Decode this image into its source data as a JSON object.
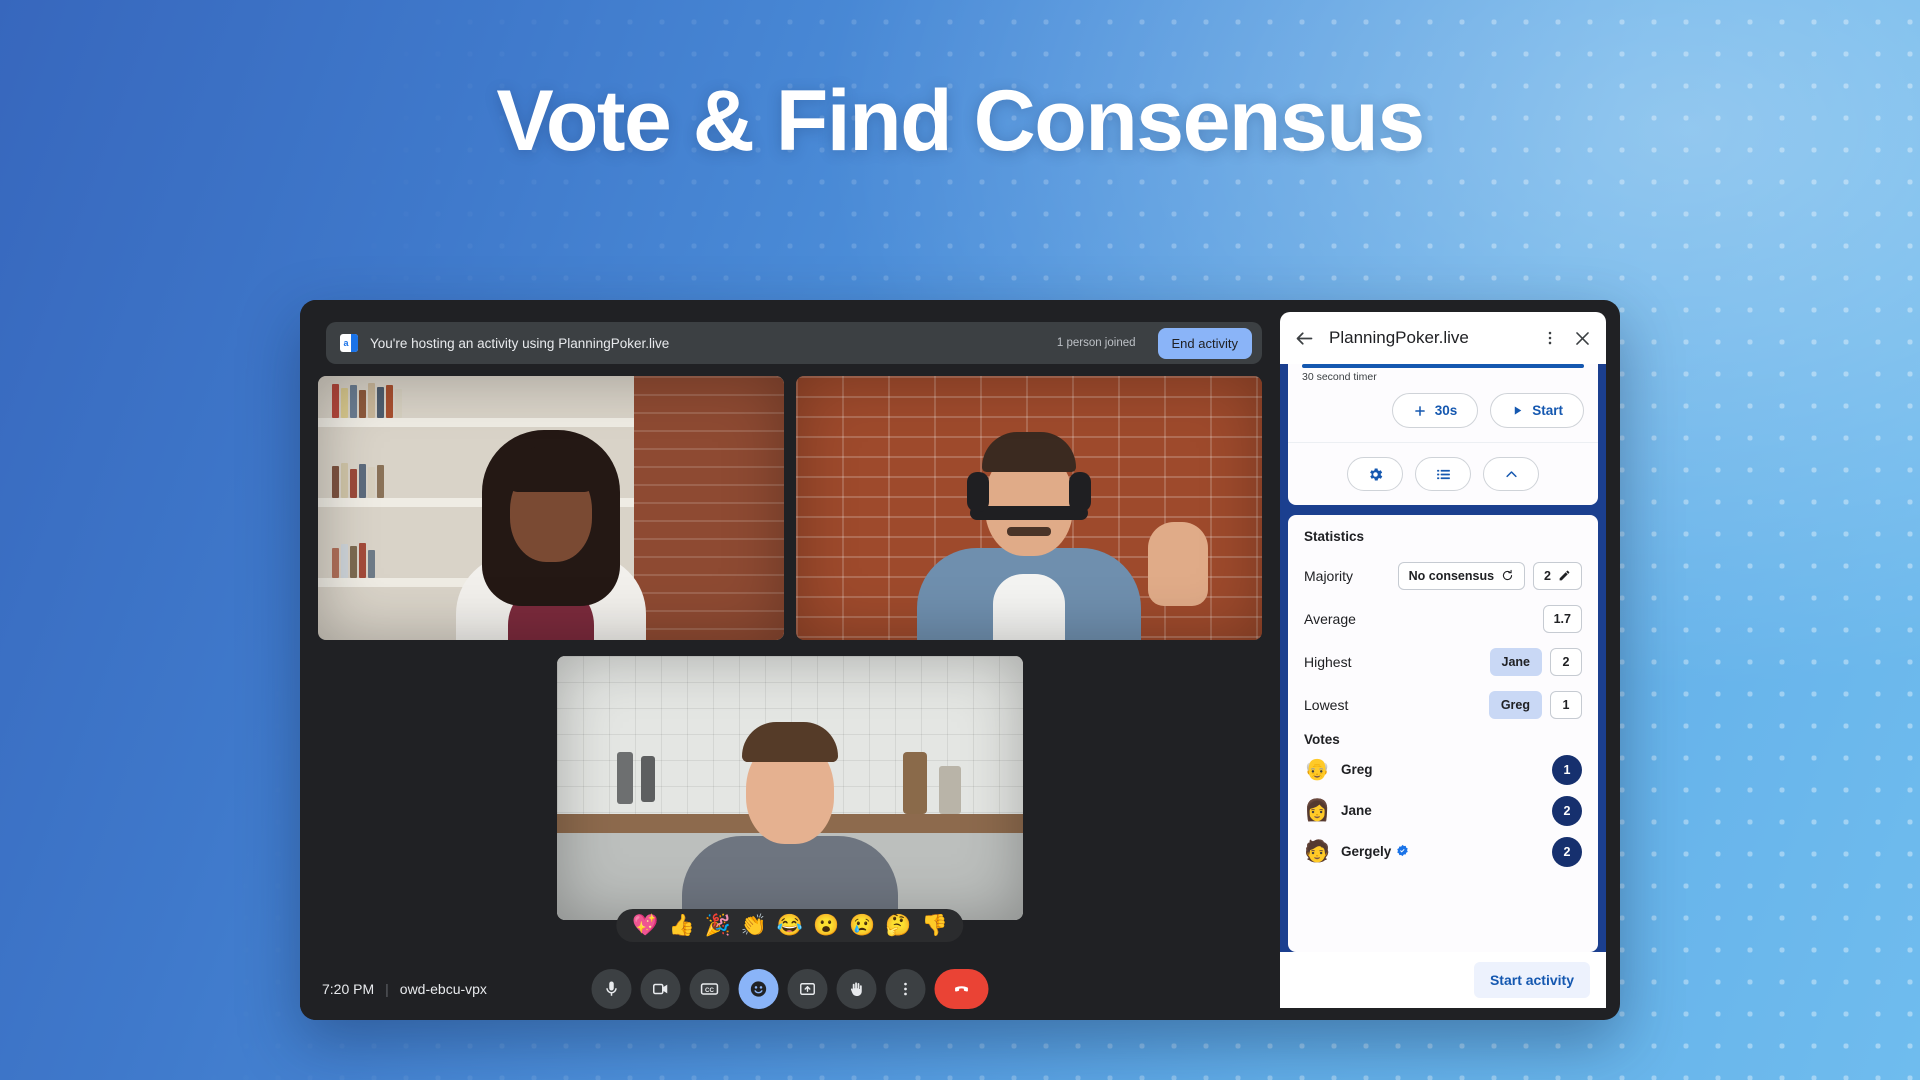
{
  "hero": {
    "title": "Vote & Find Consensus"
  },
  "meet": {
    "banner": {
      "icon": "activity-app-icon",
      "text": "You're hosting an activity using PlanningPoker.live",
      "joined_count": "1 person joined",
      "end_button": "End activity"
    },
    "tiles": [
      {
        "name": "participant-tile-1"
      },
      {
        "name": "participant-tile-2"
      },
      {
        "name": "participant-tile-3"
      }
    ],
    "reactions": [
      "💖",
      "👍",
      "🎉",
      "👏",
      "😂",
      "😮",
      "😢",
      "🤔",
      "👎"
    ],
    "footer": {
      "time": "7:20 PM",
      "separator": "|",
      "meeting_code": "owd-ebcu-vpx"
    },
    "controls": [
      {
        "name": "microphone-button",
        "icon": "microphone-icon",
        "state": "default"
      },
      {
        "name": "camera-button",
        "icon": "video-camera-icon",
        "state": "default"
      },
      {
        "name": "captions-button",
        "icon": "closed-captions-icon",
        "state": "default"
      },
      {
        "name": "reactions-button",
        "icon": "emoji-smiley-icon",
        "state": "active"
      },
      {
        "name": "present-button",
        "icon": "present-screen-icon",
        "state": "default"
      },
      {
        "name": "raise-hand-button",
        "icon": "raised-hand-icon",
        "state": "default"
      },
      {
        "name": "more-options-button",
        "icon": "more-vertical-icon",
        "state": "default"
      },
      {
        "name": "leave-call-button",
        "icon": "hangup-phone-icon",
        "state": "hangup"
      }
    ]
  },
  "panel": {
    "title": "PlanningPoker.live",
    "back_icon": "back-arrow-icon",
    "more_icon": "more-vertical-icon",
    "close_icon": "close-icon",
    "timer": {
      "label": "30 second timer",
      "progress_percent": 100,
      "add_button": "30s",
      "add_icon": "plus-icon",
      "start_button": "Start",
      "start_icon": "play-icon"
    },
    "tools": [
      {
        "name": "settings-button",
        "icon": "gear-icon"
      },
      {
        "name": "list-button",
        "icon": "list-icon"
      },
      {
        "name": "collapse-button",
        "icon": "chevron-up-icon"
      }
    ],
    "statistics": {
      "heading": "Statistics",
      "rows": [
        {
          "label": "Majority",
          "chip_text": "No consensus",
          "chip_icon": "refresh-icon",
          "value": "2",
          "value_icon": "pencil-icon"
        },
        {
          "label": "Average",
          "value": "1.7"
        },
        {
          "label": "Highest",
          "name_chip": "Jane",
          "value": "2"
        },
        {
          "label": "Lowest",
          "name_chip": "Greg",
          "value": "1"
        }
      ]
    },
    "votes": {
      "heading": "Votes",
      "items": [
        {
          "avatar": "👴",
          "name": "Greg",
          "verified": false,
          "value": "1"
        },
        {
          "avatar": "👩",
          "name": "Jane",
          "verified": false,
          "value": "2"
        },
        {
          "avatar": "🧑",
          "name": "Gergely",
          "verified": true,
          "value": "2"
        }
      ]
    },
    "footer": {
      "start_activity": "Start activity"
    }
  },
  "colors": {
    "accent_blue": "#8ab4f8",
    "panel_blue": "#1b3f8f",
    "vote_badge": "#16306e",
    "hangup_red": "#ea4335",
    "link_blue": "#1558b0"
  }
}
